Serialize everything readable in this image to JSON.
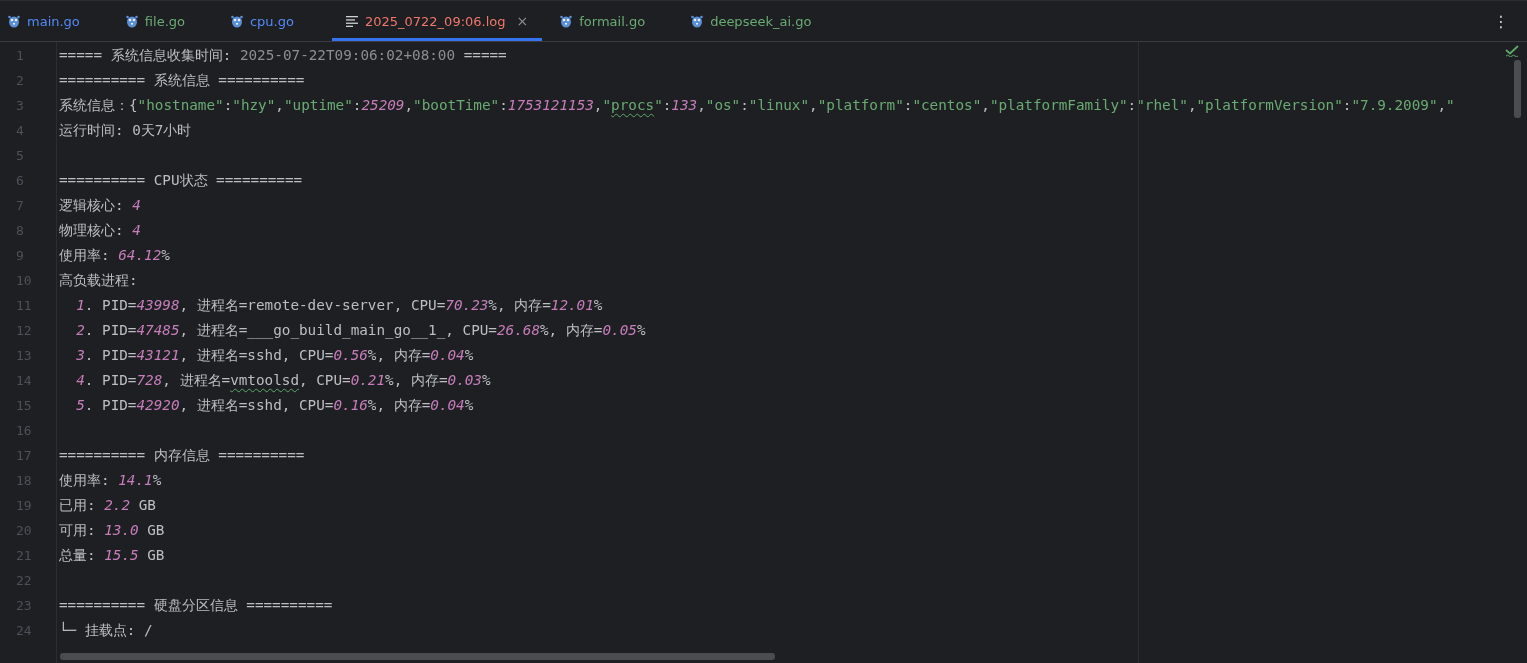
{
  "tabs": [
    {
      "label": "main.go",
      "kind": "go",
      "color": "#548af7",
      "selected": false
    },
    {
      "label": "file.go",
      "kind": "go",
      "color": "#6aab73",
      "selected": false
    },
    {
      "label": "cpu.go",
      "kind": "go",
      "color": "#548af7",
      "selected": false
    },
    {
      "label": "2025_0722_09:06.log",
      "kind": "log",
      "color": "#f0776b",
      "selected": true,
      "close": "×"
    },
    {
      "label": "formail.go",
      "kind": "go",
      "color": "#6aab73",
      "selected": false
    },
    {
      "label": "deepseek_ai.go",
      "kind": "go",
      "color": "#6aab73",
      "selected": false
    }
  ],
  "more_menu": "⋮",
  "editor": {
    "lines": [
      {
        "number": "1",
        "segments": [
          {
            "kind": "text",
            "text": "===== 系统信息收集时间: "
          },
          {
            "kind": "dim",
            "text": "2025-07-22T09:06:02+08:00"
          },
          {
            "kind": "text",
            "text": " ====="
          }
        ]
      },
      {
        "number": "2",
        "segments": [
          {
            "kind": "text",
            "text": "========== 系统信息 =========="
          }
        ]
      },
      {
        "number": "3",
        "segments": [
          {
            "kind": "text",
            "text": "系统信息：{"
          },
          {
            "kind": "str",
            "text": "\"hostname\""
          },
          {
            "kind": "text",
            "text": ":"
          },
          {
            "kind": "str",
            "text": "\"hzy\""
          },
          {
            "kind": "text",
            "text": ","
          },
          {
            "kind": "str",
            "text": "\"uptime\""
          },
          {
            "kind": "text",
            "text": ":"
          },
          {
            "kind": "num",
            "text": "25209"
          },
          {
            "kind": "text",
            "text": ","
          },
          {
            "kind": "str",
            "text": "\"bootTime\""
          },
          {
            "kind": "text",
            "text": ":"
          },
          {
            "kind": "num",
            "text": "1753121153"
          },
          {
            "kind": "text",
            "text": ","
          },
          {
            "kind": "str",
            "text": "\""
          },
          {
            "kind": "str-typo",
            "text": "procs"
          },
          {
            "kind": "str",
            "text": "\""
          },
          {
            "kind": "text",
            "text": ":"
          },
          {
            "kind": "num",
            "text": "133"
          },
          {
            "kind": "text",
            "text": ","
          },
          {
            "kind": "str",
            "text": "\"os\""
          },
          {
            "kind": "text",
            "text": ":"
          },
          {
            "kind": "str",
            "text": "\"linux\""
          },
          {
            "kind": "text",
            "text": ","
          },
          {
            "kind": "str",
            "text": "\"platform\""
          },
          {
            "kind": "text",
            "text": ":"
          },
          {
            "kind": "str",
            "text": "\"centos\""
          },
          {
            "kind": "text",
            "text": ","
          },
          {
            "kind": "str",
            "text": "\"platformFamily\""
          },
          {
            "kind": "text",
            "text": ":"
          },
          {
            "kind": "str",
            "text": "\"rhel\""
          },
          {
            "kind": "text",
            "text": ","
          },
          {
            "kind": "str",
            "text": "\"platformVersion\""
          },
          {
            "kind": "text",
            "text": ":"
          },
          {
            "kind": "str",
            "text": "\"7.9.2009\""
          },
          {
            "kind": "text",
            "text": ","
          },
          {
            "kind": "str",
            "text": "\""
          }
        ]
      },
      {
        "number": "4",
        "segments": [
          {
            "kind": "text",
            "text": "运行时间: 0天7小时"
          }
        ]
      },
      {
        "number": "5"
      },
      {
        "number": "6",
        "segments": [
          {
            "kind": "text",
            "text": "========== CPU状态 =========="
          }
        ]
      },
      {
        "number": "7",
        "segments": [
          {
            "kind": "text",
            "text": "逻辑核心: "
          },
          {
            "kind": "num",
            "text": "4"
          }
        ]
      },
      {
        "number": "8",
        "segments": [
          {
            "kind": "text",
            "text": "物理核心: "
          },
          {
            "kind": "num",
            "text": "4"
          }
        ]
      },
      {
        "number": "9",
        "segments": [
          {
            "kind": "text",
            "text": "使用率: "
          },
          {
            "kind": "num",
            "text": "64.12"
          },
          {
            "kind": "text",
            "text": "%"
          }
        ]
      },
      {
        "number": "10",
        "segments": [
          {
            "kind": "text",
            "text": "高负载进程:"
          }
        ]
      },
      {
        "number": "11",
        "indent": true,
        "segments": [
          {
            "kind": "num",
            "text": "1"
          },
          {
            "kind": "text",
            "text": ". PID="
          },
          {
            "kind": "num",
            "text": "43998"
          },
          {
            "kind": "text",
            "text": ", 进程名=remote-dev-server, CPU="
          },
          {
            "kind": "num",
            "text": "70.23"
          },
          {
            "kind": "text",
            "text": "%, 内存="
          },
          {
            "kind": "num",
            "text": "12.01"
          },
          {
            "kind": "text",
            "text": "%"
          }
        ]
      },
      {
        "number": "12",
        "indent": true,
        "segments": [
          {
            "kind": "num",
            "text": "2"
          },
          {
            "kind": "text",
            "text": ". PID="
          },
          {
            "kind": "num",
            "text": "47485"
          },
          {
            "kind": "text",
            "text": ", 进程名=___go_build_main_go__1_, CPU="
          },
          {
            "kind": "num",
            "text": "26.68"
          },
          {
            "kind": "text",
            "text": "%, 内存="
          },
          {
            "kind": "num",
            "text": "0.05"
          },
          {
            "kind": "text",
            "text": "%"
          }
        ]
      },
      {
        "number": "13",
        "indent": true,
        "segments": [
          {
            "kind": "num",
            "text": "3"
          },
          {
            "kind": "text",
            "text": ". PID="
          },
          {
            "kind": "num",
            "text": "43121"
          },
          {
            "kind": "text",
            "text": ", 进程名=sshd, CPU="
          },
          {
            "kind": "num",
            "text": "0.56"
          },
          {
            "kind": "text",
            "text": "%, 内存="
          },
          {
            "kind": "num",
            "text": "0.04"
          },
          {
            "kind": "text",
            "text": "%"
          }
        ]
      },
      {
        "number": "14",
        "indent": true,
        "segments": [
          {
            "kind": "num",
            "text": "4"
          },
          {
            "kind": "text",
            "text": ". PID="
          },
          {
            "kind": "num",
            "text": "728"
          },
          {
            "kind": "text",
            "text": ", 进程名="
          },
          {
            "kind": "typo",
            "text": "vmtoolsd"
          },
          {
            "kind": "text",
            "text": ", CPU="
          },
          {
            "kind": "num",
            "text": "0.21"
          },
          {
            "kind": "text",
            "text": "%, 内存="
          },
          {
            "kind": "num",
            "text": "0.03"
          },
          {
            "kind": "text",
            "text": "%"
          }
        ]
      },
      {
        "number": "15",
        "indent": true,
        "segments": [
          {
            "kind": "num",
            "text": "5"
          },
          {
            "kind": "text",
            "text": ". PID="
          },
          {
            "kind": "num",
            "text": "42920"
          },
          {
            "kind": "text",
            "text": ", 进程名=sshd, CPU="
          },
          {
            "kind": "num",
            "text": "0.16"
          },
          {
            "kind": "text",
            "text": "%, 内存="
          },
          {
            "kind": "num",
            "text": "0.04"
          },
          {
            "kind": "text",
            "text": "%"
          }
        ]
      },
      {
        "number": "16"
      },
      {
        "number": "17",
        "segments": [
          {
            "kind": "text",
            "text": "========== 内存信息 =========="
          }
        ]
      },
      {
        "number": "18",
        "segments": [
          {
            "kind": "text",
            "text": "使用率: "
          },
          {
            "kind": "num",
            "text": "14.1"
          },
          {
            "kind": "text",
            "text": "%"
          }
        ]
      },
      {
        "number": "19",
        "segments": [
          {
            "kind": "text",
            "text": "已用: "
          },
          {
            "kind": "num",
            "text": "2.2"
          },
          {
            "kind": "text",
            "text": " GB"
          }
        ]
      },
      {
        "number": "20",
        "segments": [
          {
            "kind": "text",
            "text": "可用: "
          },
          {
            "kind": "num",
            "text": "13.0"
          },
          {
            "kind": "text",
            "text": " GB"
          }
        ]
      },
      {
        "number": "21",
        "segments": [
          {
            "kind": "text",
            "text": "总量: "
          },
          {
            "kind": "num",
            "text": "15.5"
          },
          {
            "kind": "text",
            "text": " GB"
          }
        ]
      },
      {
        "number": "22"
      },
      {
        "number": "23",
        "segments": [
          {
            "kind": "text",
            "text": "========== 硬盘分区信息 =========="
          }
        ]
      },
      {
        "number": "24",
        "segments": [
          {
            "kind": "text",
            "text": "└─ 挂载点: /"
          }
        ]
      }
    ]
  }
}
